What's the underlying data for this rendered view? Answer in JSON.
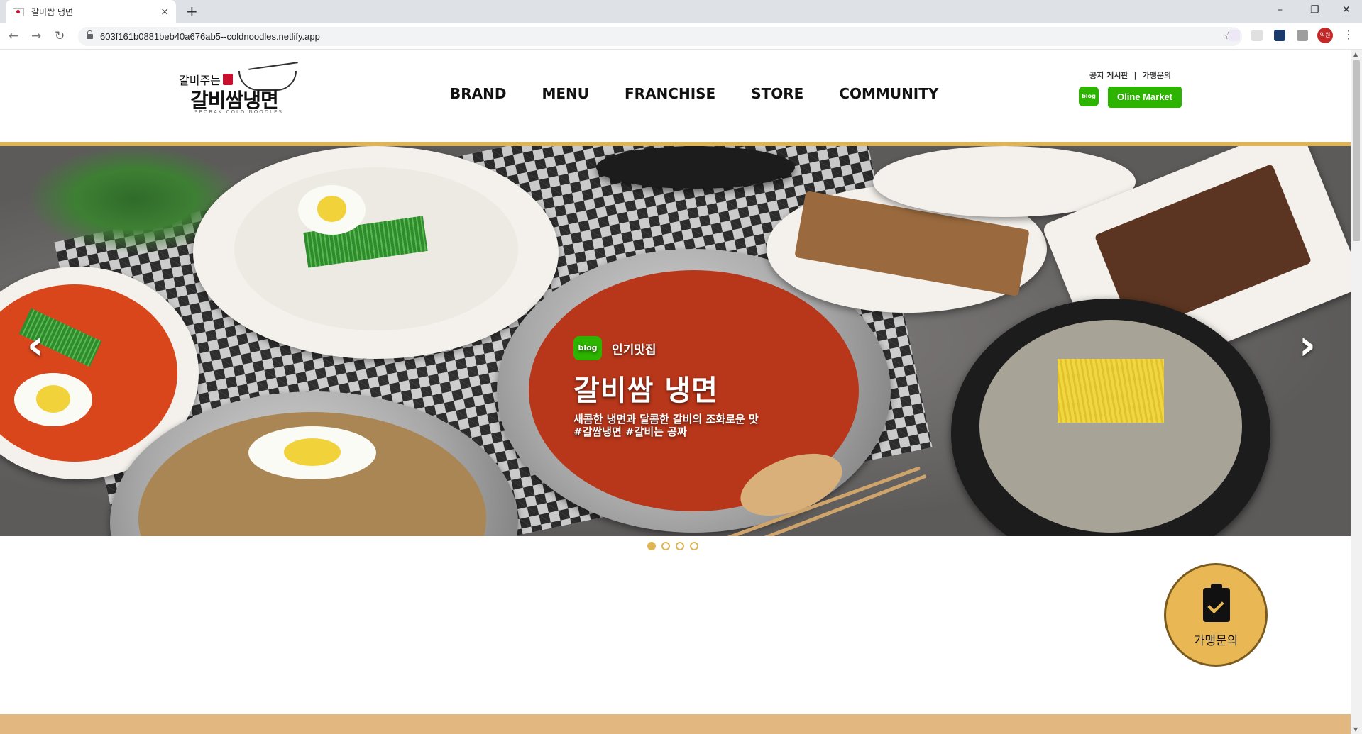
{
  "browser": {
    "tab_title": "갈비쌈 냉면",
    "tab_close": "×",
    "new_tab": "+",
    "url": "603f161b0881beb40a676ab5--coldnoodles.netlify.app",
    "profile_label": "익원",
    "window_controls": {
      "minimize": "–",
      "maximize": "❐",
      "close": "✕"
    }
  },
  "header": {
    "logo": {
      "small_text": "갈비주는",
      "big_text": "갈비쌈냉면",
      "sub_text": "SEORAK COLD NOODLES"
    },
    "nav": [
      "BRAND",
      "MENU",
      "FRANCHISE",
      "STORE",
      "COMMUNITY"
    ],
    "util_links": [
      "공지 게시판",
      "가맹문의"
    ],
    "util_separator": "|",
    "blog_badge": "blog",
    "market_button": "Oline Market"
  },
  "hero": {
    "badge": "blog",
    "tag": "인기맛집",
    "headline": "갈비쌈 냉면",
    "desc_line1": "새콤한 냉면과 달콤한 갈비의 조화로운 맛",
    "desc_line2": "#갈쌈냉면 #갈비는 공짜",
    "prev_arrow": "‹",
    "next_arrow": "›",
    "slide_count": 4,
    "active_slide": 0
  },
  "fab": {
    "label": "가맹문의",
    "icon": "clipboard-check-icon"
  },
  "colors": {
    "accent_gold": "#dfb454",
    "naver_green": "#2db400",
    "fab_bg": "#e9b855",
    "band": "#e2b880"
  }
}
